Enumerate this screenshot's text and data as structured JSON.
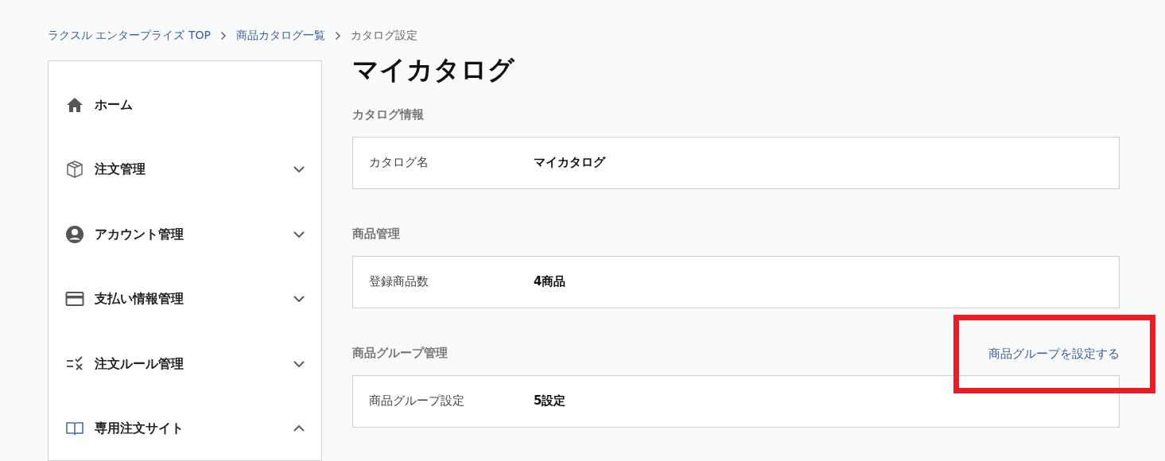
{
  "breadcrumb": [
    {
      "label": "ラクスル エンタープライズ TOP"
    },
    {
      "label": "商品カタログ一覧"
    },
    {
      "label": "カタログ設定"
    }
  ],
  "sidebar": {
    "items": [
      {
        "label": "ホーム"
      },
      {
        "label": "注文管理",
        "expanded": false
      },
      {
        "label": "アカウント管理",
        "expanded": false
      },
      {
        "label": "支払い情報管理",
        "expanded": false
      },
      {
        "label": "注文ルール管理",
        "expanded": false
      },
      {
        "label": "専用注文サイト",
        "expanded": true
      }
    ]
  },
  "page_title": "マイカタログ",
  "sections": [
    {
      "heading": "カタログ情報",
      "rows": [
        {
          "label": "カタログ名",
          "value": "マイカタログ"
        }
      ]
    },
    {
      "heading": "商品管理",
      "rows": [
        {
          "label": "登録商品数",
          "value": "4商品"
        }
      ]
    },
    {
      "heading": "商品グループ管理",
      "action": {
        "label": "商品グループを設定する",
        "highlighted": true
      },
      "rows": [
        {
          "label": "商品グループ設定",
          "value": "5設定"
        }
      ]
    }
  ]
}
